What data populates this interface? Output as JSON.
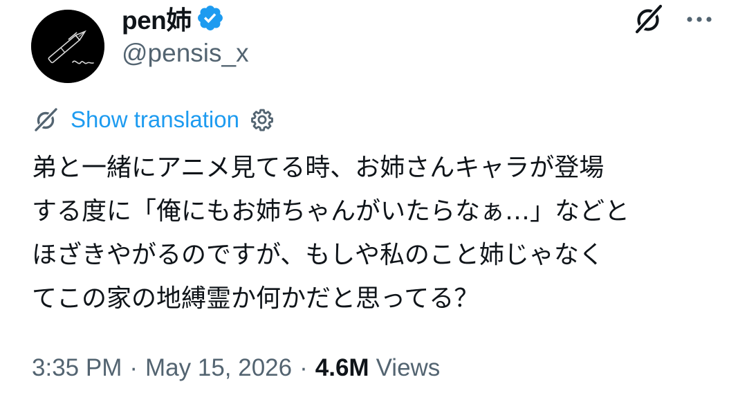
{
  "author": {
    "display_name": "pen姉",
    "handle": "@pensis_x",
    "avatar_icon": "fountain-pen-icon",
    "verified_icon": "verified-badge-icon",
    "verified_color": "#1d9bf0"
  },
  "header_actions": {
    "grok_icon": "grok-icon",
    "more_icon": "more-horizontal-icon"
  },
  "translation": {
    "label": "Show translation",
    "translate_icon": "grok-translate-icon",
    "settings_icon": "gear-icon",
    "link_color": "#1d9bf0"
  },
  "tweet": {
    "lines": [
      "弟と一緒にアニメ見てる時、お姉さんキャラが登場",
      "する度に「俺にもお姉ちゃんがいたらなぁ…」などと",
      "ほざきやがるのですが、もしや私のこと姉じゃなく",
      "てこの家の地縛霊か何かだと思ってる？"
    ]
  },
  "meta": {
    "time": "3:35 PM",
    "separator": "·",
    "date": "May 15, 2026",
    "views_count": "4.6M",
    "views_label": "Views",
    "muted_color": "#536471"
  }
}
